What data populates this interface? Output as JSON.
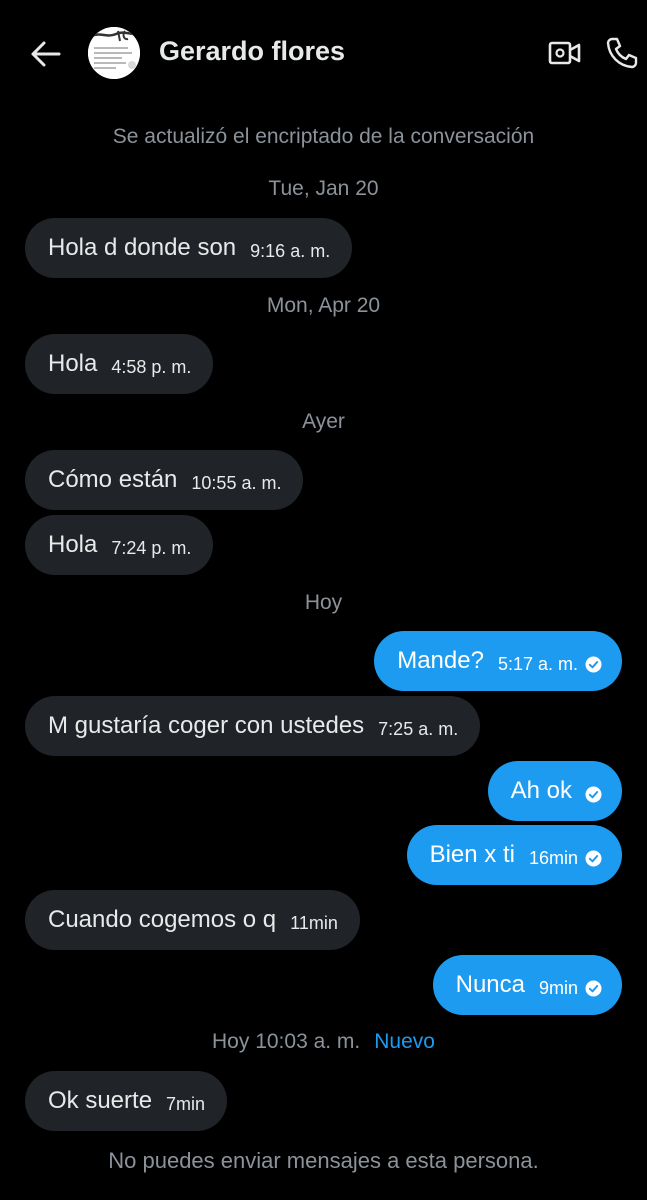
{
  "header": {
    "back_icon": "arrow-left-icon",
    "contact_name": "Gerardo flores",
    "video_icon": "video-call-icon",
    "phone_icon": "phone-icon"
  },
  "conversation": {
    "encryption_notice": "Se actualizó el encriptado de la conversación",
    "footer_notice": "No puedes enviar mensajes a esta persona."
  },
  "dates": {
    "d1": "Tue, Jan 20",
    "d2": "Mon, Apr 20",
    "d3": "Ayer",
    "d4": "Hoy",
    "d5": "Hoy 10:03 a. m.",
    "new_label": "Nuevo"
  },
  "messages": [
    {
      "text": "Hola d donde son",
      "time": "9:16 a. m.",
      "direction": "incoming"
    },
    {
      "text": "Hola",
      "time": "4:58 p. m.",
      "direction": "incoming"
    },
    {
      "text": "Cómo están",
      "time": "10:55 a. m.",
      "direction": "incoming"
    },
    {
      "text": "Hola",
      "time": "7:24 p. m.",
      "direction": "incoming"
    },
    {
      "text": "Mande?",
      "time": "5:17 a. m.",
      "direction": "outgoing",
      "seen": true
    },
    {
      "text": "M gustaría coger con ustedes",
      "time": "7:25 a. m.",
      "direction": "incoming"
    },
    {
      "text": "Ah ok",
      "time": "",
      "direction": "outgoing",
      "seen": true
    },
    {
      "text": "Bien x ti",
      "time": "16min",
      "direction": "outgoing",
      "seen": true
    },
    {
      "text": "Cuando cogemos o q",
      "time": "11min",
      "direction": "incoming"
    },
    {
      "text": "Nunca",
      "time": "9min",
      "direction": "outgoing",
      "seen": true
    },
    {
      "text": "Ok suerte",
      "time": "7min",
      "direction": "incoming"
    }
  ],
  "colors": {
    "background": "#000000",
    "incoming_bubble": "#202327",
    "outgoing_bubble": "#1d9bf0",
    "muted_text": "#8b9299",
    "accent": "#1d9bf0"
  }
}
